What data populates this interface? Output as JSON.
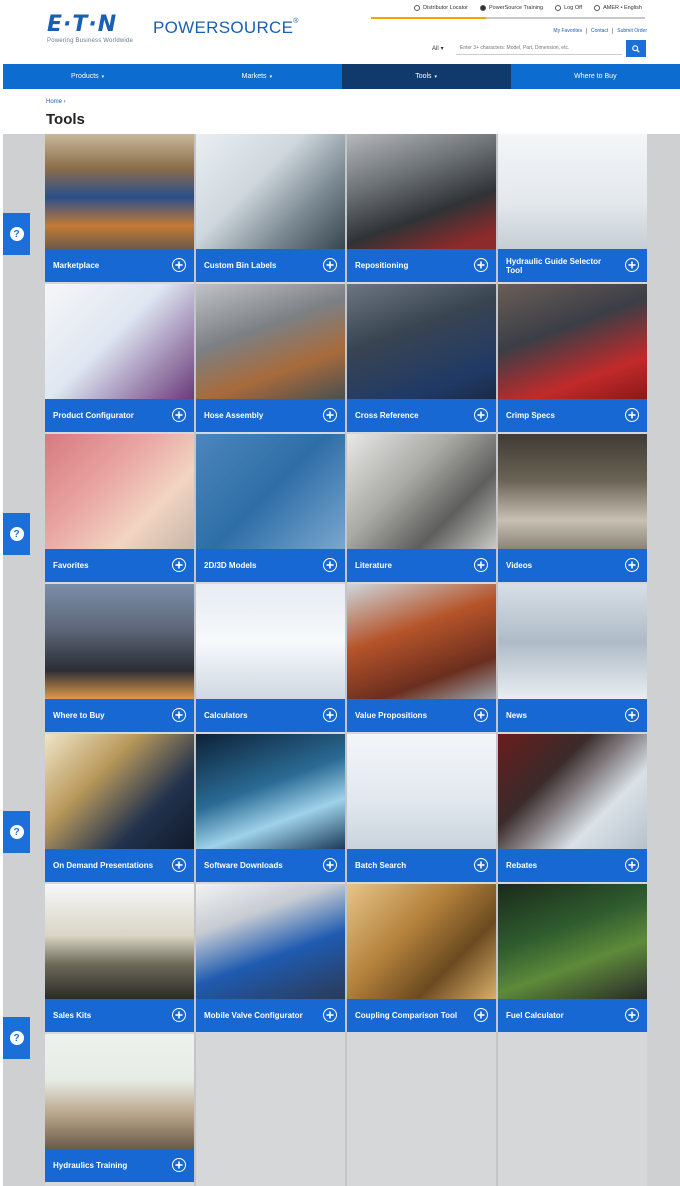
{
  "brand": {
    "logo_text": "E·T·N",
    "tagline": "Powering Business Worldwide",
    "product_power": "POWER",
    "product_source": "SOURCE",
    "product_mark": "®"
  },
  "utility_bar": {
    "items": [
      {
        "label": "Distributor Locator",
        "icon": "location-icon"
      },
      {
        "label": "PowerSource Training",
        "icon": "help-icon"
      },
      {
        "label": "Log Off",
        "icon": "user-icon"
      },
      {
        "label": "AMER • English",
        "icon": "globe-icon"
      }
    ],
    "sub_links": [
      "My Favorites",
      "Contact",
      "Submit Order"
    ]
  },
  "search": {
    "category": "All",
    "placeholder": "Enter 3+ characters: Model, Part, Dimension, etc."
  },
  "nav": {
    "items": [
      {
        "label": "Products",
        "caret": true
      },
      {
        "label": "Markets",
        "caret": true
      },
      {
        "label": "Tools",
        "caret": true,
        "active": true
      },
      {
        "label": "Where to Buy",
        "caret": false
      }
    ]
  },
  "breadcrumb": "Home  ›",
  "page_title": "Tools",
  "help_label": "?",
  "tiles": [
    {
      "label": "Marketplace",
      "icon": "warehouse-image"
    },
    {
      "label": "Custom Bin Labels",
      "icon": "labels-image"
    },
    {
      "label": "Repositioning",
      "icon": "hoses-image"
    },
    {
      "label": "Hydraulic Guide Selector Tool",
      "icon": "devices-image"
    },
    {
      "label": "Product Configurator",
      "icon": "laptop-image"
    },
    {
      "label": "Hose Assembly",
      "icon": "fittings-image"
    },
    {
      "label": "Cross Reference",
      "icon": "man-image"
    },
    {
      "label": "Crimp Specs",
      "icon": "crimper-image"
    },
    {
      "label": "Favorites",
      "icon": "writing-image"
    },
    {
      "label": "2D/3D Models",
      "icon": "part-image"
    },
    {
      "label": "Literature",
      "icon": "metal-image"
    },
    {
      "label": "Videos",
      "icon": "presenter-image"
    },
    {
      "label": "Where to Buy",
      "icon": "city-image"
    },
    {
      "label": "Calculators",
      "icon": "screen-image"
    },
    {
      "label": "Value Propositions",
      "icon": "building-image"
    },
    {
      "label": "News",
      "icon": "machine-image"
    },
    {
      "label": "On Demand Presentations",
      "icon": "projector-image"
    },
    {
      "label": "Software Downloads",
      "icon": "network-image"
    },
    {
      "label": "Batch Search",
      "icon": "webpage-image"
    },
    {
      "label": "Rebates",
      "icon": "laptop2-image"
    },
    {
      "label": "Sales Kits",
      "icon": "tablet-image"
    },
    {
      "label": "Mobile Valve Configurator",
      "icon": "valve-image"
    },
    {
      "label": "Coupling Comparison Tool",
      "icon": "coupling-image"
    },
    {
      "label": "Fuel Calculator",
      "icon": "nozzle-image"
    },
    {
      "label": "Hydraulics Training",
      "icon": "people-image"
    }
  ]
}
